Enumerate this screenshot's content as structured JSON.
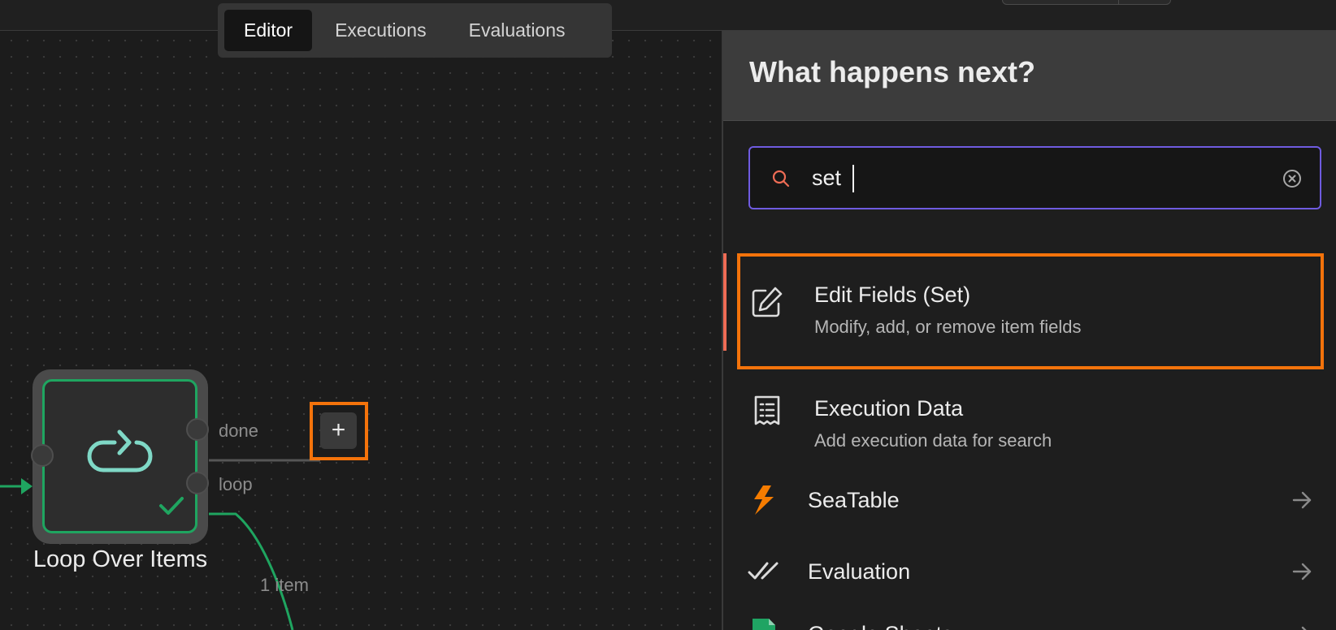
{
  "tabs": [
    {
      "label": "Editor",
      "active": true
    },
    {
      "label": "Executions",
      "active": false
    },
    {
      "label": "Evaluations",
      "active": false
    }
  ],
  "node": {
    "title": "Loop Over Items",
    "icon": "loop-icon",
    "status": "success",
    "outputs": {
      "done_label": "done",
      "loop_label": "loop"
    },
    "connection_label": "1 item"
  },
  "add_button": {
    "label": "+"
  },
  "panel": {
    "title": "What happens next?",
    "search": {
      "value": "set",
      "placeholder": ""
    },
    "results": [
      {
        "name": "Edit Fields (Set)",
        "description": "Modify, add, or remove item fields",
        "icon": "pencil-square-icon",
        "selected": true
      },
      {
        "name": "Execution Data",
        "description": "Add execution data for search",
        "icon": "receipt-icon"
      },
      {
        "name": "SeaTable",
        "icon": "seatable-icon",
        "has_arrow": true
      },
      {
        "name": "Evaluation",
        "icon": "double-check-icon",
        "has_arrow": true
      },
      {
        "name": "Google Sheets",
        "icon": "google-sheets-icon",
        "has_arrow": true
      }
    ]
  },
  "colors": {
    "accent_purple": "#6f5be0",
    "success_green": "#1fa560",
    "highlight_orange": "#f4730b",
    "seatable_orange": "#f57c00",
    "search_icon": "#ee6c55"
  }
}
